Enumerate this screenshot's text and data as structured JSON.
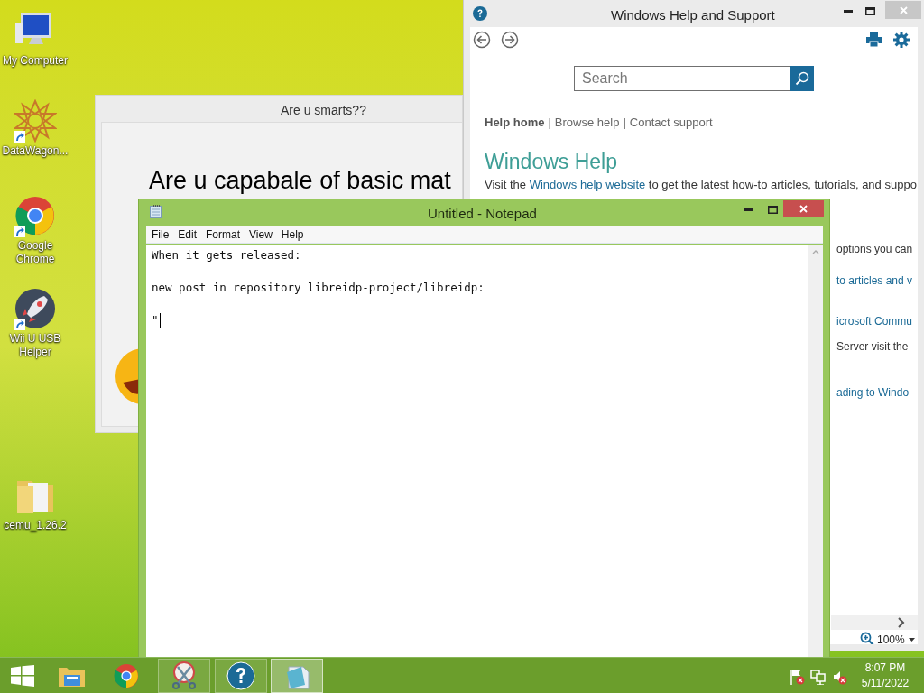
{
  "desktop_icons": [
    {
      "kind": "computer",
      "label": "My Computer"
    },
    {
      "kind": "star",
      "label": "DataWagon..."
    },
    {
      "kind": "browser",
      "label": "Google Chrome"
    },
    {
      "kind": "rocket",
      "label": "Wii U USB Helper"
    },
    {
      "kind": "folder",
      "label": "cemu_1.26.2"
    }
  ],
  "quiz_window": {
    "title": "Are u smarts??",
    "question": "Are u capabale of basic mat"
  },
  "help_window": {
    "title": "Windows Help and Support",
    "search": {
      "placeholder": "Search"
    },
    "nav_links": [
      {
        "label": "Help home",
        "selected": true
      },
      {
        "label": "Browse help",
        "selected": false
      },
      {
        "label": "Contact support",
        "selected": false
      }
    ],
    "separator": "|",
    "heading": "Windows Help",
    "intro": {
      "before": "Visit the ",
      "link": "Windows help website",
      "after": " to get the latest how-to articles, tutorials, and suppo"
    },
    "fragments": [
      {
        "kind": "text",
        "text": "options you can"
      },
      {
        "kind": "link",
        "text": "to articles and v"
      },
      {
        "kind": "link",
        "text": "icrosoft Commu"
      },
      {
        "kind": "text",
        "text": "Server visit the"
      },
      {
        "kind": "link",
        "text": "ading to Windo"
      }
    ],
    "zoom": "100%"
  },
  "notepad": {
    "title": "Untitled - Notepad",
    "menu": [
      "File",
      "Edit",
      "Format",
      "View",
      "Help"
    ],
    "lines": [
      "When it gets released:",
      "new post in repository libreidp-project/libreidp:",
      "\""
    ]
  },
  "taskbar": {
    "buttons": [
      {
        "kind": "start",
        "selected": false
      },
      {
        "kind": "explorer",
        "selected": false
      },
      {
        "kind": "browser",
        "selected": false
      },
      {
        "kind": "snipping",
        "selected": false
      },
      {
        "kind": "help",
        "selected": false
      },
      {
        "kind": "notepad",
        "selected": true
      }
    ],
    "clock": {
      "time": "8:07 PM",
      "date": "5/11/2022"
    }
  }
}
